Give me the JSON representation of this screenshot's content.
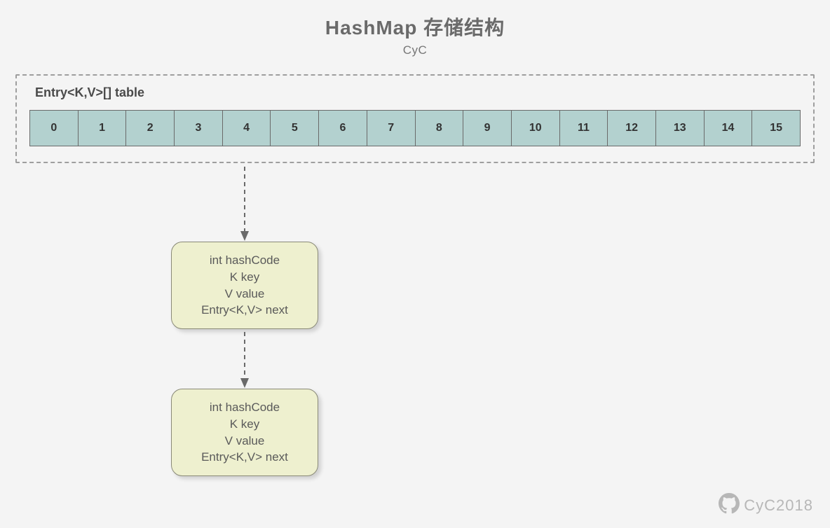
{
  "title": "HashMap 存储结构",
  "subtitle": "CyC",
  "outer_label": "Entry<K,V>[] table",
  "buckets": [
    "0",
    "1",
    "2",
    "3",
    "4",
    "5",
    "6",
    "7",
    "8",
    "9",
    "10",
    "11",
    "12",
    "13",
    "14",
    "15"
  ],
  "entry_fields": {
    "line1": "int hashCode",
    "line2": "K key",
    "line3": "V value",
    "line4": "Entry<K,V> next"
  },
  "linked_from_bucket_index": 4,
  "credit": "CyC2018"
}
